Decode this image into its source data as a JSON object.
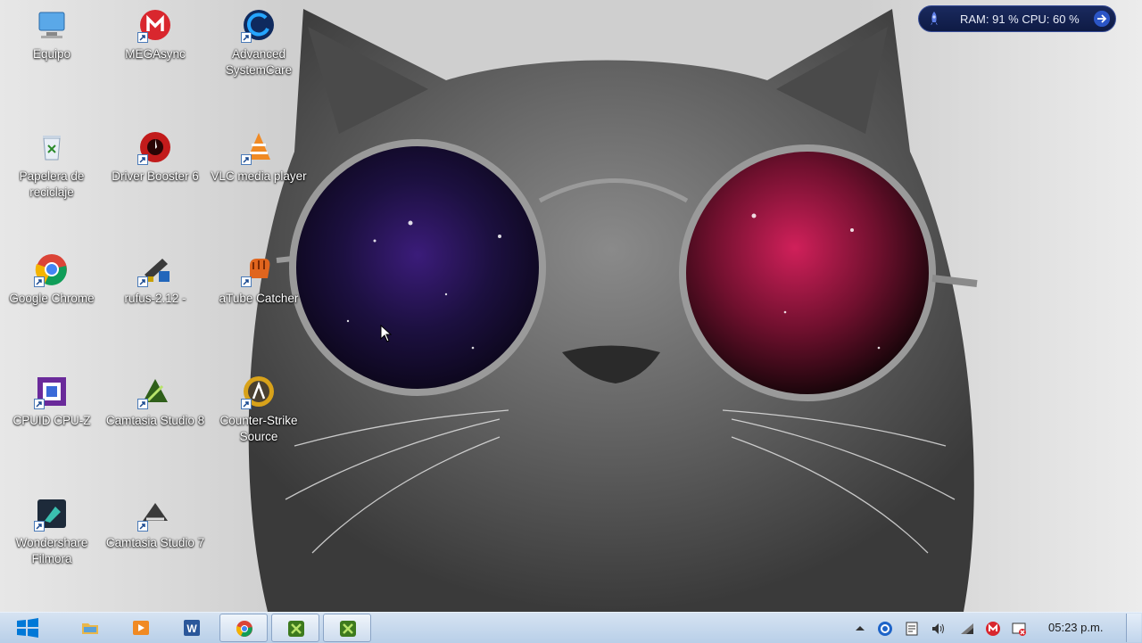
{
  "desktop": {
    "icons": [
      {
        "label": "Equipo",
        "icon": "computer-icon"
      },
      {
        "label": "MEGAsync",
        "icon": "megasync-icon"
      },
      {
        "label": "Advanced SystemCare",
        "icon": "advanced-systemcare-icon"
      },
      {
        "label": "Papelera de reciclaje",
        "icon": "recycle-bin-icon"
      },
      {
        "label": "Driver Booster 6",
        "icon": "driver-booster-icon"
      },
      {
        "label": "VLC media player",
        "icon": "vlc-icon"
      },
      {
        "label": "Google Chrome",
        "icon": "chrome-icon"
      },
      {
        "label": "rufus-2.12 -",
        "icon": "rufus-icon"
      },
      {
        "label": "aTube Catcher",
        "icon": "atube-catcher-icon"
      },
      {
        "label": "CPUID CPU-Z",
        "icon": "cpuz-icon"
      },
      {
        "label": "Camtasia Studio 8",
        "icon": "camtasia-8-icon"
      },
      {
        "label": "Counter-Strike Source",
        "icon": "counter-strike-icon"
      },
      {
        "label": "Wondershare Filmora",
        "icon": "filmora-icon"
      },
      {
        "label": "Camtasia Studio 7",
        "icon": "camtasia-7-icon"
      }
    ]
  },
  "gadget": {
    "text": "RAM: 91 %  CPU: 60 %"
  },
  "taskbar": {
    "clock": "05:23 p.m.",
    "pinned": [
      "start-button",
      "file-explorer-icon",
      "media-player-icon",
      "word-icon",
      "chrome-icon",
      "camtasia-icon",
      "camtasia-icon"
    ]
  },
  "colors": {
    "taskbar_top": "#d6e3f2",
    "taskbar_bottom": "#b8cfe8",
    "gadget_bg": "#1a2a5e",
    "lens_left": "#2a1a6a",
    "lens_right": "#b01040"
  }
}
